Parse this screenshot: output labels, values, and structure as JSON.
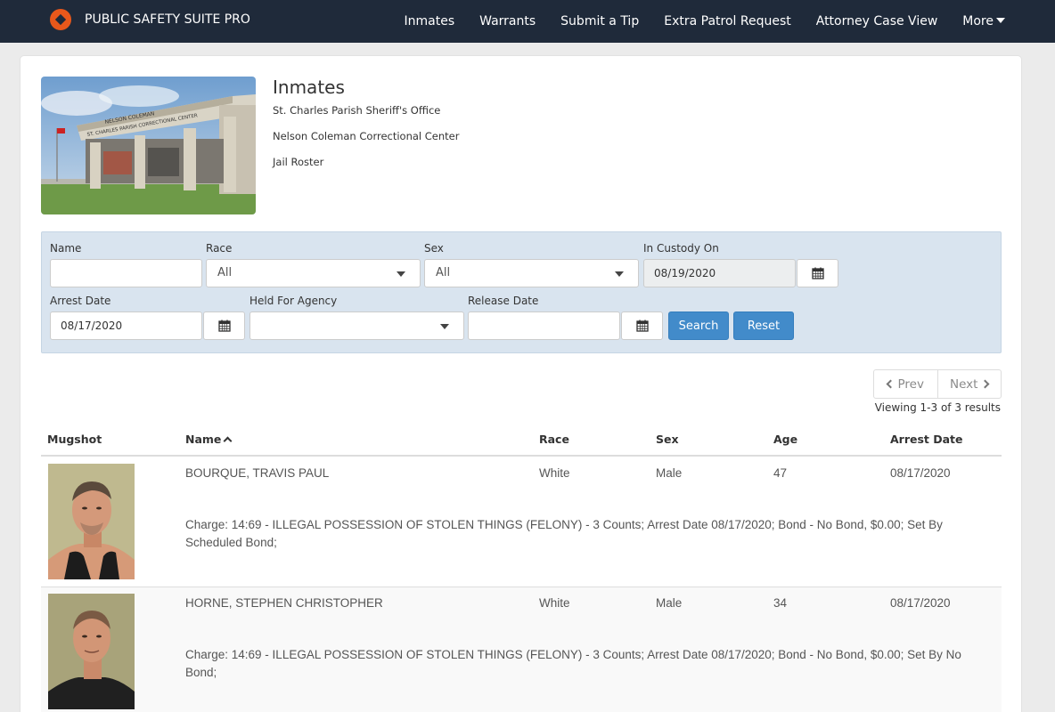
{
  "navbar": {
    "brand": "PUBLIC SAFETY SUITE PRO",
    "links": [
      {
        "label": "Inmates"
      },
      {
        "label": "Warrants"
      },
      {
        "label": "Submit a Tip"
      },
      {
        "label": "Extra Patrol Request"
      },
      {
        "label": "Attorney Case View"
      },
      {
        "label": "More"
      }
    ]
  },
  "header": {
    "title": "Inmates",
    "agency": "St. Charles Parish Sheriff's Office",
    "facility": "Nelson Coleman Correctional Center",
    "roster": "Jail Roster",
    "photo_signage": [
      "NELSON COLEMAN",
      "ST. CHARLES PARISH CORRECTIONAL CENTER"
    ]
  },
  "filters": {
    "name_label": "Name",
    "name_value": "",
    "race_label": "Race",
    "race_value": "All",
    "sex_label": "Sex",
    "sex_value": "All",
    "custody_label": "In Custody On",
    "custody_value": "08/19/2020",
    "arrest_label": "Arrest Date",
    "arrest_value": "08/17/2020",
    "agency_label": "Held For Agency",
    "agency_value": "",
    "release_label": "Release Date",
    "release_value": "",
    "search_label": "Search",
    "reset_label": "Reset"
  },
  "pager": {
    "prev": "Prev",
    "next": "Next",
    "viewing": "Viewing 1-3 of 3 results"
  },
  "table": {
    "headers": {
      "mugshot": "Mugshot",
      "name": "Name",
      "race": "Race",
      "sex": "Sex",
      "age": "Age",
      "arrest_date": "Arrest Date"
    },
    "rows": [
      {
        "name": "BOURQUE, TRAVIS PAUL",
        "race": "White",
        "sex": "Male",
        "age": "47",
        "arrest_date": "08/17/2020",
        "charge": "Charge: 14:69 - ILLEGAL POSSESSION OF STOLEN THINGS (FELONY) - 3 Counts; Arrest Date 08/17/2020; Bond - No Bond, $0.00; Set By Scheduled Bond;"
      },
      {
        "name": "HORNE, STEPHEN CHRISTOPHER",
        "race": "White",
        "sex": "Male",
        "age": "34",
        "arrest_date": "08/17/2020",
        "charge": "Charge: 14:69 - ILLEGAL POSSESSION OF STOLEN THINGS (FELONY) - 3 Counts; Arrest Date 08/17/2020; Bond - No Bond, $0.00; Set By No Bond;"
      }
    ]
  },
  "colors": {
    "navbar": "#1f2a3a",
    "brand_accent": "#e9581b",
    "filter_panel": "#d9e4ef",
    "primary_button": "#428bca"
  },
  "icons": [
    "brand-logo-icon",
    "caret-down-icon",
    "calendar-icon",
    "chevron-left-icon",
    "chevron-right-icon",
    "sort-ascending-icon"
  ]
}
